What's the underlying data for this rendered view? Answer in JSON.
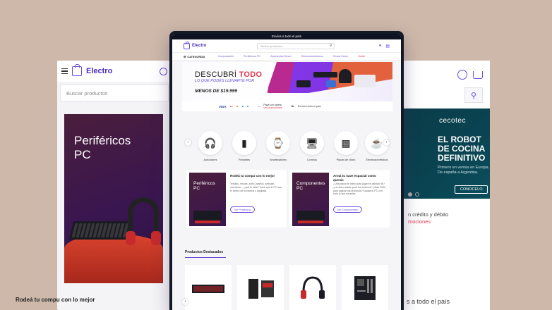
{
  "colors": {
    "accent": "#6b4bd8",
    "brand": "#4b2dbb",
    "sale": "#e2384f",
    "background": "#cdb8a9"
  },
  "left_mobile": {
    "brand": "Electro",
    "search_placeholder": "Buscar productos",
    "banner_title": "Periféricos\nPC",
    "caption": "Rodeá tu compu con lo mejor"
  },
  "right_mobile": {
    "banner_brand": "cecotec",
    "banner_headline": "EL ROBOT\nDE COCINA\nDEFINITIVO",
    "banner_sub": "Primero en ventas en Europa.\nDe españa a Argentina.",
    "banner_cta": "CONOCELO",
    "promo_line1": "n crédito y débito",
    "promo_line2": "mociones",
    "shipping": "s a todo el país"
  },
  "desktop": {
    "announcement": "Envíos a todo el país",
    "brand": "Electro",
    "search_placeholder": "Buscar productos",
    "nav": {
      "categories_label": "CATEGORÍAS",
      "items": [
        "Computación",
        "Periféricos PC",
        "Accesorios Smart",
        "Electrodomésticos",
        "Smart Home",
        "Outlet"
      ]
    },
    "hero": {
      "title_a": "DESCUBRÍ ",
      "title_b": "TODO",
      "subtitle": "LO QUE PODÉS LLEVARTE POR",
      "price": "MENOS DE $19.999",
      "pay_visa": "VISA",
      "pay_text_1": "Pagá con tarjeta",
      "pay_text_1b": "Ver promociones",
      "pay_text_2": "Envíos a todo el país"
    },
    "categories": [
      "Auriculares",
      "Parlantes",
      "Smartwatches",
      "Combos",
      "Placas de video",
      "Electrodomésticos"
    ],
    "promos": [
      {
        "image_title": "Periféricos\nPC",
        "title": "Rodeá tu compu con lo mejor",
        "text": "Teclado, mouse, auris, joystick, webcam, micrófono... ¿qué te falta? Hacé que tu PC sea el centro de la escena y equipala.",
        "button": "Ver Periféricos"
      },
      {
        "image_title": "Componentes\nPC",
        "title": "Armá tu nave espacial como querás",
        "text": "¿Una placa de video para jugar en calidad 4K? ¿Un disco sólido para tus archivos? ¿Más RAM para agilizar los procesos? Equipá tu PC con todo lo que necesita.",
        "button": "Ver Componentes"
      }
    ],
    "featured_title": "Productos Destacados"
  }
}
